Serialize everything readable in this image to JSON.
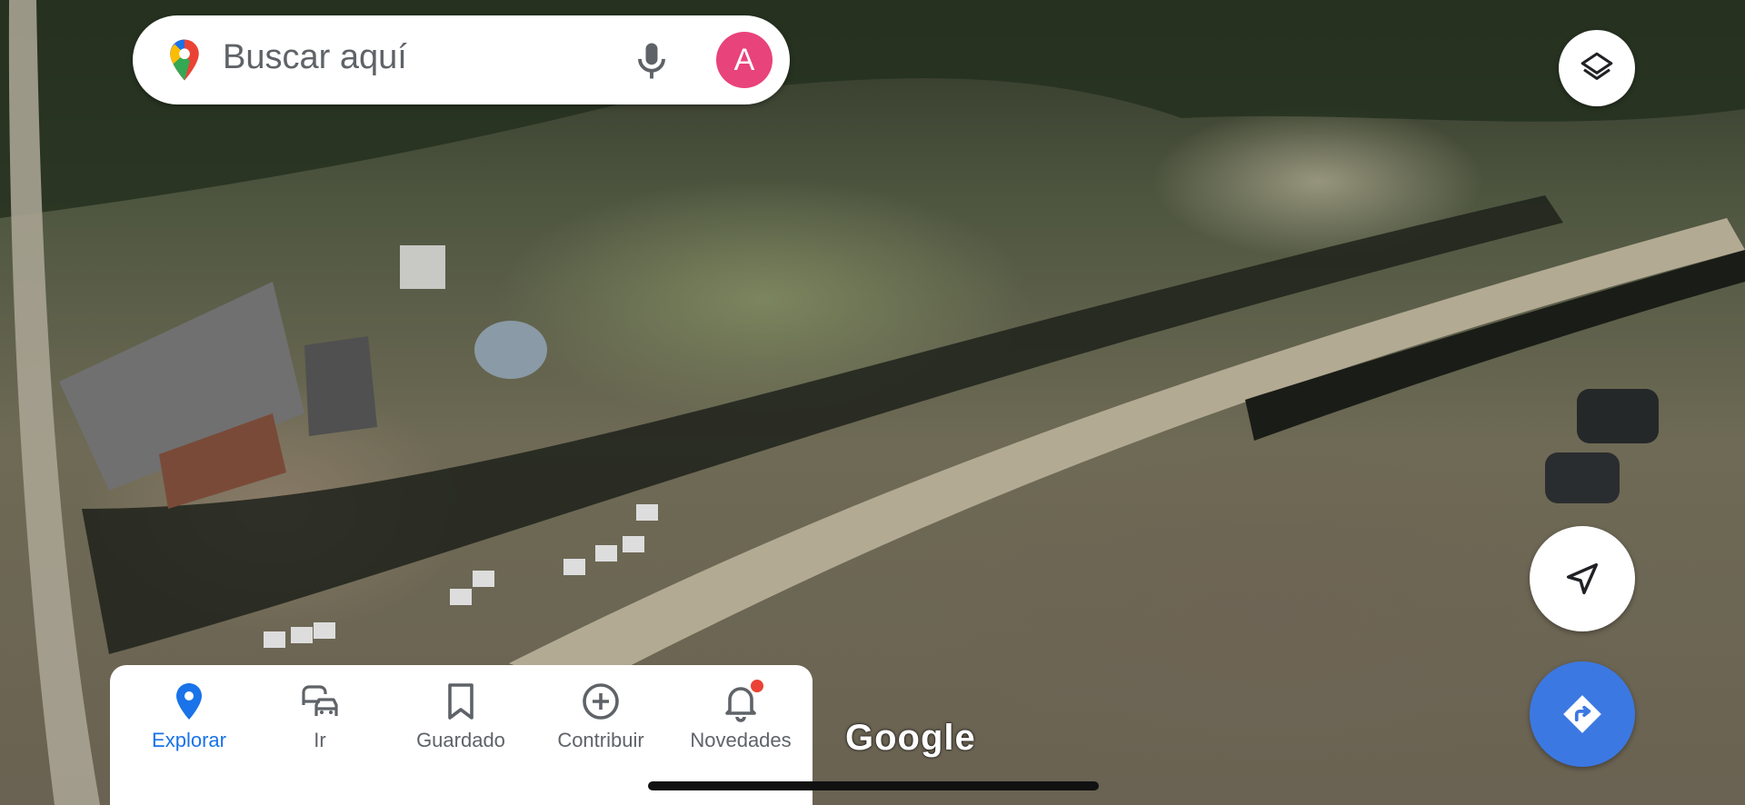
{
  "search": {
    "placeholder": "Buscar aquí",
    "avatar_initial": "A",
    "avatar_color": "#e8437a",
    "pin_icon": "google-maps-pin-icon",
    "mic_icon": "microphone-icon"
  },
  "map_controls": {
    "layers_icon": "layers-icon",
    "locate_icon": "navigation-arrow-icon",
    "directions_icon": "directions-icon",
    "directions_color": "#3c78e2"
  },
  "bottom_nav": {
    "items": [
      {
        "label": "Explorar",
        "icon": "location-pin-icon",
        "active": true
      },
      {
        "label": "Ir",
        "icon": "commute-icon",
        "active": false
      },
      {
        "label": "Guardado",
        "icon": "bookmark-icon",
        "active": false
      },
      {
        "label": "Contribuir",
        "icon": "add-circle-icon",
        "active": false
      },
      {
        "label": "Novedades",
        "icon": "bell-icon",
        "active": false,
        "has_badge": true
      }
    ],
    "active_color": "#1a73e8",
    "badge_color": "#ea4335"
  },
  "map": {
    "type": "satellite",
    "attribution": "Google"
  }
}
